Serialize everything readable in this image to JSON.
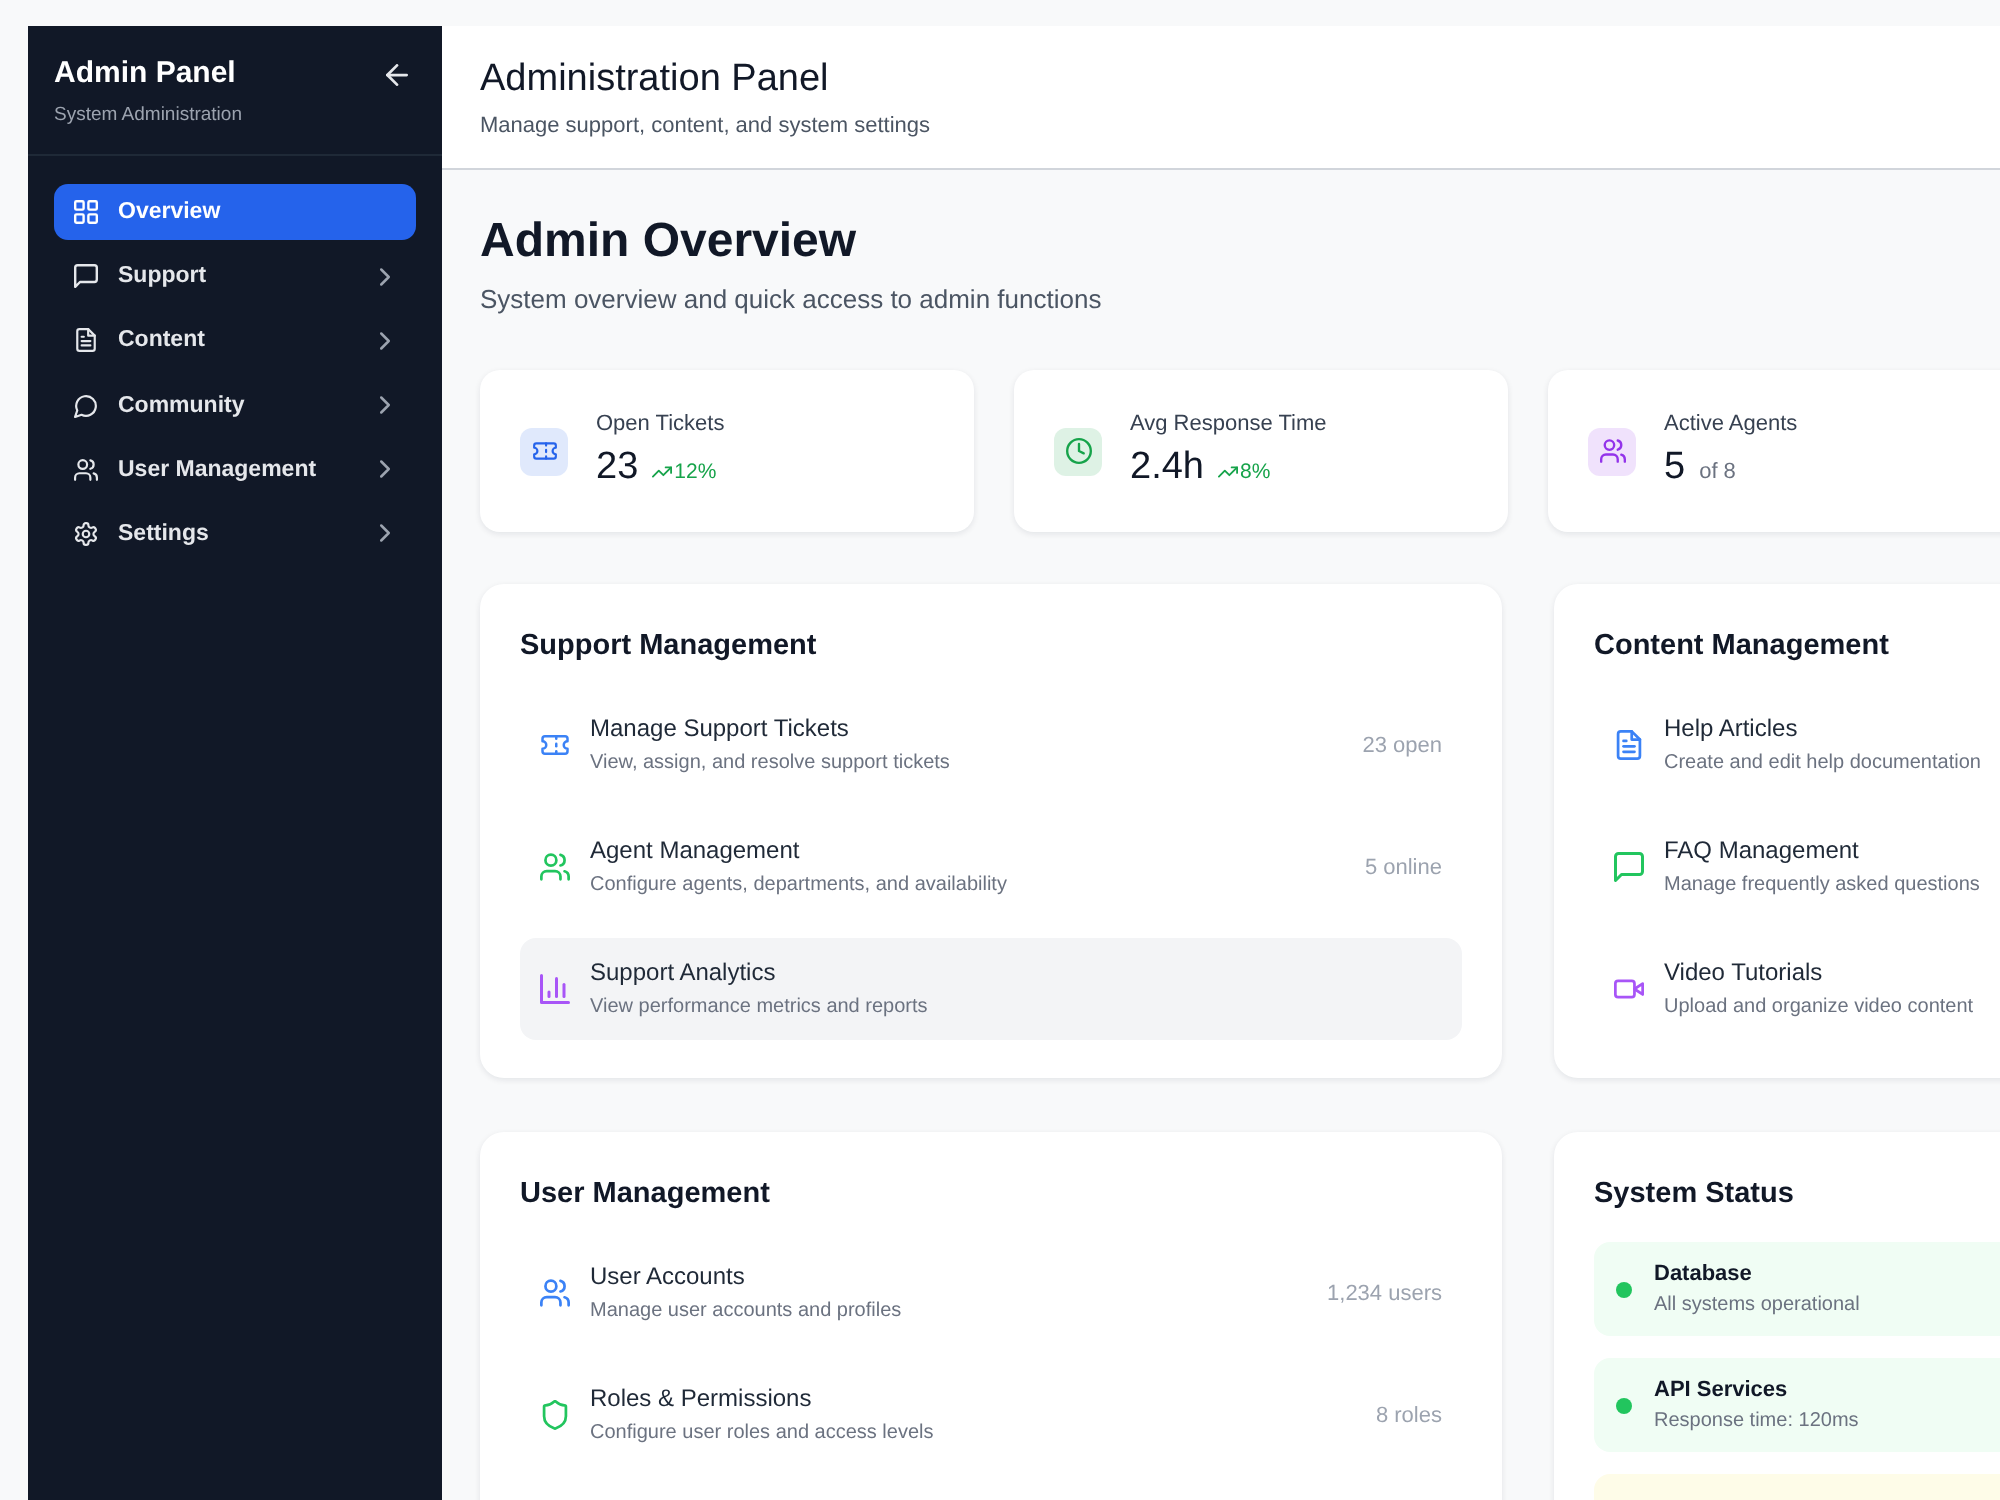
{
  "sidebar": {
    "title": "Admin Panel",
    "subtitle": "System Administration",
    "items": [
      {
        "label": "Overview",
        "kind": "grid",
        "selected": true,
        "expandable": false
      },
      {
        "label": "Support",
        "kind": "message",
        "selected": false,
        "expandable": true
      },
      {
        "label": "Content",
        "kind": "document",
        "selected": false,
        "expandable": true
      },
      {
        "label": "Community",
        "kind": "chat",
        "selected": false,
        "expandable": true
      },
      {
        "label": "User Management",
        "kind": "users",
        "selected": false,
        "expandable": true
      },
      {
        "label": "Settings",
        "kind": "gear",
        "selected": false,
        "expandable": true
      }
    ]
  },
  "header": {
    "title": "Administration Panel",
    "subtitle": "Manage support, content, and system settings"
  },
  "page": {
    "title": "Admin Overview",
    "subtitle": "System overview and quick access to admin functions"
  },
  "stats": [
    {
      "label": "Open Tickets",
      "value": "23",
      "kind": "ticket",
      "color": "#2563eb",
      "trend": "12%"
    },
    {
      "label": "Avg Response Time",
      "value": "2.4h",
      "kind": "clock",
      "color": "#16a34a",
      "trend": "8%"
    },
    {
      "label": "Active Agents",
      "value": "5",
      "kind": "users",
      "color": "#9333ea",
      "note": "of 8"
    }
  ],
  "panels": [
    {
      "kind": "links",
      "title": "Support Management",
      "items": [
        {
          "title": "Manage Support Tickets",
          "description": "View, assign, and resolve support tickets",
          "kind": "ticket",
          "color": "#3b82f6",
          "count": "23 open",
          "highlighted": false
        },
        {
          "title": "Agent Management",
          "description": "Configure agents, departments, and availability",
          "kind": "users",
          "color": "#22c55e",
          "count": "5 online",
          "highlighted": false
        },
        {
          "title": "Support Analytics",
          "description": "View performance metrics and reports",
          "kind": "chart",
          "color": "#a855f7",
          "highlighted": true
        }
      ]
    },
    {
      "kind": "links",
      "title": "Content Management",
      "items": [
        {
          "title": "Help Articles",
          "description": "Create and edit help documentation",
          "kind": "document",
          "color": "#3b82f6",
          "highlighted": false
        },
        {
          "title": "FAQ Management",
          "description": "Manage frequently asked questions",
          "kind": "message",
          "color": "#22c55e",
          "highlighted": false
        },
        {
          "title": "Video Tutorials",
          "description": "Upload and organize video content",
          "kind": "video",
          "color": "#a855f7",
          "highlighted": false
        }
      ]
    },
    {
      "kind": "links",
      "title": "User Management",
      "items": [
        {
          "title": "User Accounts",
          "description": "Manage user accounts and profiles",
          "kind": "users",
          "color": "#3b82f6",
          "count": "1,234 users",
          "highlighted": false
        },
        {
          "title": "Roles & Permissions",
          "description": "Configure user roles and access levels",
          "kind": "shield",
          "color": "#22c55e",
          "count": "8 roles",
          "highlighted": false
        }
      ]
    },
    {
      "kind": "status",
      "title": "System Status",
      "items": [
        {
          "name": "Database",
          "detail": "All systems operational",
          "kind": "ok"
        },
        {
          "name": "API Services",
          "detail": "Response time: 120ms",
          "kind": "ok"
        },
        {
          "kind": "warning"
        }
      ]
    }
  ]
}
